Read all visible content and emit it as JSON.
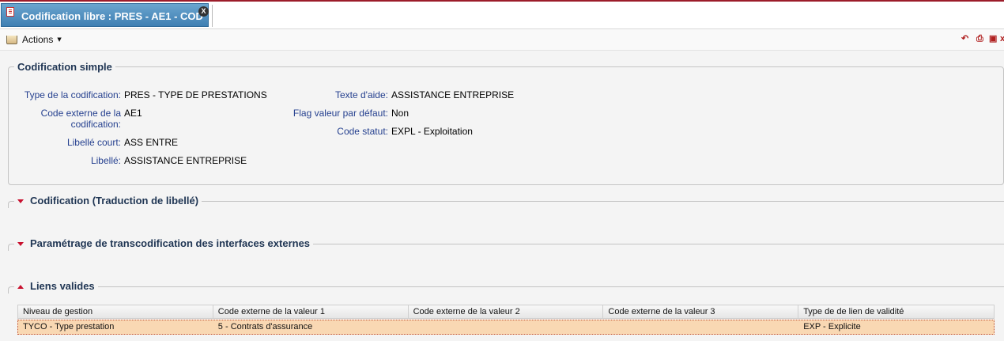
{
  "tab": {
    "title": "Codification libre : PRES - AE1 - COD",
    "close_label": "X"
  },
  "toolbar": {
    "actions_label": "Actions"
  },
  "section_simple": {
    "title": "Codification simple",
    "fields_left": [
      {
        "label": "Type de la codification:",
        "value": "PRES - TYPE DE PRESTATIONS"
      },
      {
        "label": "Code externe de la codification:",
        "value": "AE1"
      },
      {
        "label": "Libellé court:",
        "value": "ASS ENTRE"
      },
      {
        "label": "Libellé:",
        "value": "ASSISTANCE ENTREPRISE"
      }
    ],
    "fields_right": [
      {
        "label": "Texte d'aide:",
        "value": "ASSISTANCE ENTREPRISE"
      },
      {
        "label": "Flag valeur par défaut:",
        "value": "Non"
      },
      {
        "label": "Code statut:",
        "value": "EXPL - Exploitation"
      }
    ]
  },
  "section_traduction": {
    "title": "Codification (Traduction de libellé)",
    "state": "collapsed"
  },
  "section_transco": {
    "title": "Paramétrage de transcodification des interfaces externes",
    "state": "collapsed"
  },
  "section_liens": {
    "title": "Liens valides",
    "state": "expanded",
    "columns": [
      "Niveau de gestion",
      "Code externe de la valeur 1",
      "Code externe de la valeur 2",
      "Code externe de la valeur 3",
      "Type de de lien de validité"
    ],
    "rows": [
      [
        "TYCO - Type prestation",
        "5 - Contrats d'assurance",
        "",
        "",
        "EXP - Explicite"
      ]
    ]
  },
  "colors": {
    "accent": "#c8102e",
    "tab": "#4a8bbf",
    "label": "#25408f",
    "selected_row": "#f9d8b3"
  }
}
